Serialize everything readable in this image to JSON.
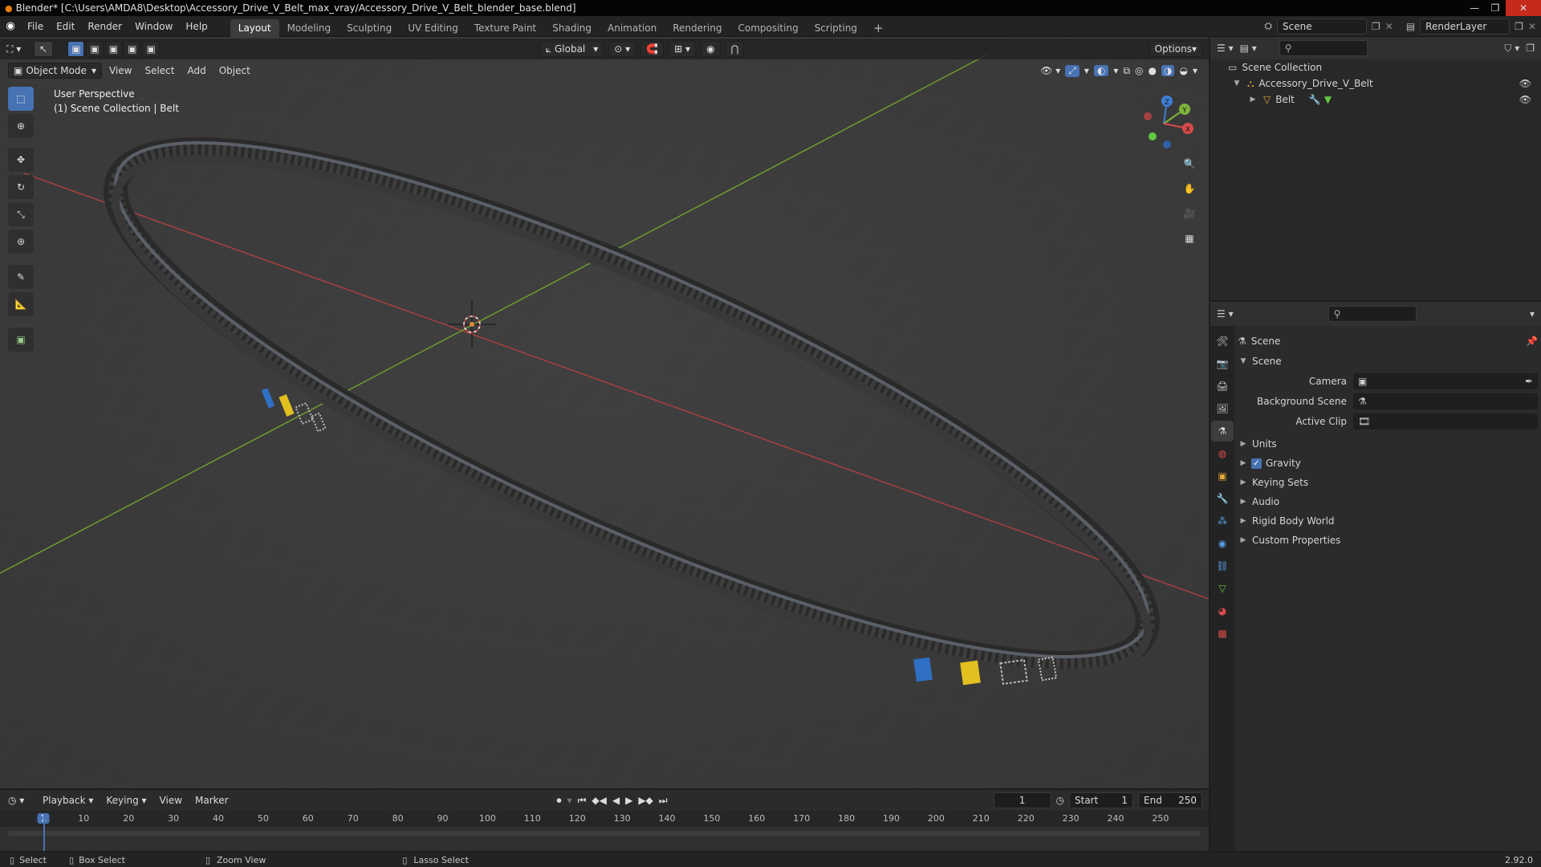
{
  "titlebar": {
    "title": "Blender* [C:\\Users\\AMDA8\\Desktop\\Accessory_Drive_V_Belt_max_vray/Accessory_Drive_V_Belt_blender_base.blend]"
  },
  "menu": {
    "file": "File",
    "edit": "Edit",
    "render": "Render",
    "window": "Window",
    "help": "Help"
  },
  "workspaces": [
    "Layout",
    "Modeling",
    "Sculpting",
    "UV Editing",
    "Texture Paint",
    "Shading",
    "Animation",
    "Rendering",
    "Compositing",
    "Scripting"
  ],
  "scene_field": "Scene",
  "renderlayer_field": "RenderLayer",
  "viewport": {
    "mode": "Object Mode",
    "menus": {
      "view": "View",
      "select": "Select",
      "add": "Add",
      "object": "Object"
    },
    "transform_orientation": "Global",
    "options": "Options",
    "overlay_title": "User Perspective",
    "overlay_subtitle": "(1) Scene Collection | Belt",
    "gizmo": {
      "x": "X",
      "y": "Y",
      "z": "Z"
    }
  },
  "outliner": {
    "scene_collection": "Scene Collection",
    "collection": "Accessory_Drive_V_Belt",
    "object": "Belt"
  },
  "properties": {
    "context": "Scene",
    "panel_title": "Scene",
    "camera_label": "Camera",
    "background_scene_label": "Background Scene",
    "active_clip_label": "Active Clip",
    "subpanels": [
      "Units",
      "Gravity",
      "Keying Sets",
      "Audio",
      "Rigid Body World",
      "Custom Properties"
    ],
    "gravity_checked": true
  },
  "timeline": {
    "playback": "Playback",
    "keying": "Keying",
    "view": "View",
    "marker": "Marker",
    "current_frame": "1",
    "start_label": "Start",
    "start": "1",
    "end_label": "End",
    "end": "250",
    "ruler": [
      "1",
      "10",
      "20",
      "30",
      "40",
      "50",
      "60",
      "70",
      "80",
      "90",
      "100",
      "110",
      "120",
      "130",
      "140",
      "150",
      "160",
      "170",
      "180",
      "190",
      "200",
      "210",
      "220",
      "230",
      "240",
      "250"
    ]
  },
  "statusbar": {
    "select": "Select",
    "box_select": "Box Select",
    "zoom_view": "Zoom View",
    "lasso_select": "Lasso Select",
    "version": "2.92.0"
  },
  "colors": {
    "accent": "#4772b3",
    "x_axis": "#d84a4a",
    "y_axis": "#7fb33a",
    "z_axis": "#3f7fd8"
  }
}
